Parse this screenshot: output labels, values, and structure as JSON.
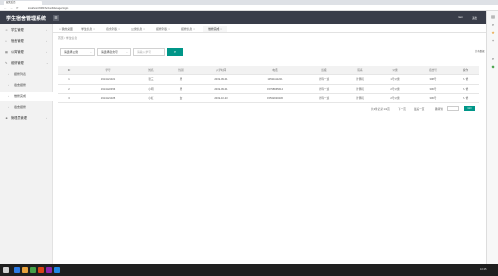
{
  "browser": {
    "tab_title": "宿舍后台",
    "url": "localhost:8080/SchoolManager/login",
    "back_glyph": "←",
    "forward_glyph": "→",
    "reload_glyph": "⟳"
  },
  "header": {
    "title": "学生宿舍管理系统",
    "toggle_glyph": "☰",
    "user": "root",
    "logout": "退出"
  },
  "sidebar": {
    "items": [
      {
        "icon": "user-icon",
        "glyph": "☺",
        "label": "学生管理",
        "arrow": "‹"
      },
      {
        "icon": "home-icon",
        "glyph": "⌂",
        "label": "宿舍管理",
        "arrow": "‹"
      },
      {
        "icon": "building-icon",
        "glyph": "▦",
        "label": "公寓管理",
        "arrow": "‹"
      },
      {
        "icon": "wrench-icon",
        "glyph": "✎",
        "label": "维修管理",
        "arrow": "⌄"
      }
    ],
    "subitems": [
      {
        "label": "报修列表"
      },
      {
        "label": "宿舍报修"
      },
      {
        "label": "维修完成"
      },
      {
        "label": "宿舍报修"
      }
    ],
    "last": {
      "icon": "person-icon",
      "glyph": "☻",
      "label": "管理员管理",
      "arrow": "‹"
    }
  },
  "tabs": [
    {
      "label": "我的桌面"
    },
    {
      "label": "学生信息"
    },
    {
      "label": "宿舍列表"
    },
    {
      "label": "公寓信息"
    },
    {
      "label": "报修列表"
    },
    {
      "label": "报修信息"
    },
    {
      "label": "维修完成"
    }
  ],
  "breadcrumb": "首页 / 学生信息",
  "filters": {
    "apartment": "请选择公寓",
    "dorm": "请选择宿舍号",
    "search_placeholder": "请输入学号",
    "search_glyph": "⌕"
  },
  "table": {
    "headers": [
      "ID",
      "学号",
      "姓名",
      "性别",
      "入学时间",
      "电话",
      "班级",
      "院系",
      "公寓",
      "宿舍号",
      "操作"
    ],
    "rows": [
      [
        "1",
        "1914121321",
        "张三",
        "男",
        "2019-09-01",
        "13511111221",
        "计科一班",
        "计算机",
        "1号公寓",
        "308号",
        "✎ 修"
      ],
      [
        "2",
        "1914122456",
        "小明",
        "男",
        "2019-09-01",
        "15798665614",
        "计科一班",
        "计算机",
        "2号公寓",
        "306号",
        "✎ 修"
      ],
      [
        "3",
        "1914121325",
        "小红",
        "女",
        "2019-10-23",
        "15532020236",
        "计科一班",
        "计算机",
        "2号公寓",
        "306号",
        "✎ 修"
      ]
    ]
  },
  "pager": {
    "summary": "共3条记录 1/1页",
    "prev": "下一页",
    "last": "最后一页",
    "jump": "跳转到",
    "go": "GO"
  },
  "rail_icons": [
    {
      "name": "rail-grid-icon",
      "glyph": "▤"
    },
    {
      "name": "rail-search-icon",
      "glyph": "⌕"
    },
    {
      "name": "rail-star-icon",
      "glyph": "★"
    },
    {
      "name": "rail-add-icon",
      "glyph": "+"
    },
    {
      "name": "rail-search2-icon",
      "glyph": "⌕"
    },
    {
      "name": "rail-tag-icon",
      "glyph": "◆"
    }
  ],
  "rail_label": "共有数据",
  "taskbar": {
    "time": "10:25",
    "icons": [
      "#2d7be5",
      "#e8a13c",
      "#43a047",
      "#d84315",
      "#8e24aa",
      "#1e88e5"
    ]
  }
}
